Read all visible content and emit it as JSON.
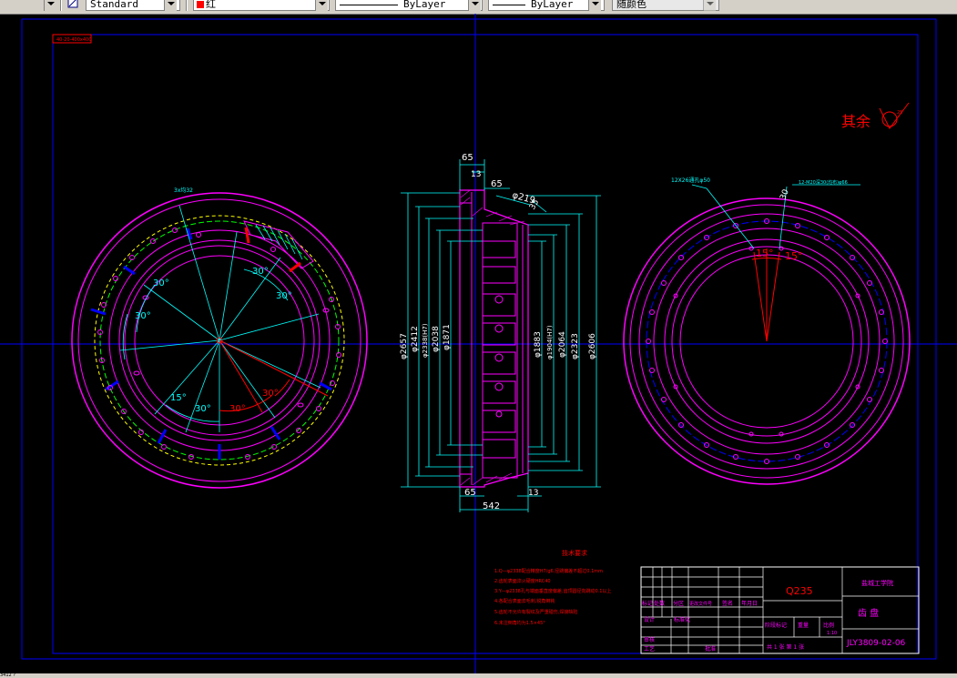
{
  "toolbar": {
    "textstyle_value": "Standard",
    "color_value": "红",
    "linetype_value": "ByLayer",
    "lineweight_value": "ByLayer",
    "plotstyle_value": "随颜色"
  },
  "status_bar": {
    "coords": "3412 ?"
  },
  "drawing": {
    "corner_tag": "40-20-400x400",
    "roughness_text": "其余",
    "roughness_value": "25",
    "left_view": {
      "label_top": "3x均32",
      "angles": [
        "30°",
        "30°",
        "30°",
        "30°",
        "15°",
        "30°",
        "30°",
        "30°"
      ]
    },
    "section_view": {
      "top_dims": [
        "65",
        "13",
        "65",
        "φ219",
        "35"
      ],
      "bottom_dims": [
        "65",
        "542",
        "13"
      ],
      "left_dia": [
        "φ2657",
        "φ2412",
        "φ2338(H7)",
        "φ2038",
        "φ1871"
      ],
      "right_dia": [
        "φ1883",
        "φ1904(H7)",
        "φ2064",
        "φ2323",
        "φ2606"
      ]
    },
    "right_view": {
      "label_left": "12X26通孔φ50",
      "label_right": "12-M20深30(均布)φ66",
      "angles": [
        "15°",
        "15°"
      ],
      "r_label": "30"
    },
    "tech_notes": {
      "title": "技术要求",
      "items": [
        "1.Q—φ2338配合精度H7/g6,径跳偏差不超过0.1mm",
        "2.齿轮表面淬火硬度HRC40",
        "3.Y—φ2338孔与端面垂直度偏差,齿顶圆径向跳动0.1以上",
        "4.各配合表面去毛刺,锐角倒钝",
        "5.齿轮不允许有裂纹及严重碰伤,焊接缺陷",
        "6.未注倒角均为1.5×45°"
      ]
    },
    "title_block": {
      "material": "Q235",
      "school": "盐城工学院",
      "part_name": "齿 盘",
      "drawing_no": "JLY3809-02-06",
      "scale": "1:10",
      "row_labels": [
        "标记",
        "处数",
        "分区",
        "更改文件号",
        "签名",
        "年月日"
      ],
      "left_labels": [
        "设计",
        "标准化",
        "审核",
        "工艺",
        "批准"
      ],
      "stage_labels": [
        "阶段标记",
        "重量",
        "比例"
      ],
      "sheet_text": "共 1 张  第 1 张"
    }
  },
  "colors": {
    "background": "#000000",
    "frame": "#0000ff",
    "magenta": "#ff00ff",
    "cyan": "#00ffff",
    "red": "#ff0000"
  }
}
